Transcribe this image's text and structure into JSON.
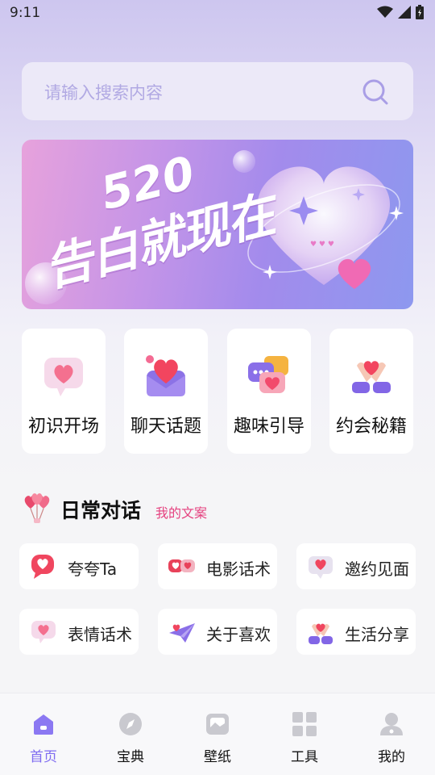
{
  "status_bar": {
    "time": "9:11"
  },
  "search": {
    "placeholder": "请输入搜索内容"
  },
  "banner": {
    "line1": "520",
    "line2": "告白就现在"
  },
  "features": [
    {
      "label": "初识开场",
      "icon": "heart-bubble-icon"
    },
    {
      "label": "聊天话题",
      "icon": "love-envelope-icon"
    },
    {
      "label": "趣味引导",
      "icon": "chat-bubbles-icon"
    },
    {
      "label": "约会秘籍",
      "icon": "hands-heart-icon"
    }
  ],
  "section": {
    "title": "日常对话",
    "subtitle": "我的文案"
  },
  "chips": [
    {
      "label": "夸夸Ta",
      "icon": "heart-speech-icon"
    },
    {
      "label": "电影话术",
      "icon": "double-heart-bubble-icon"
    },
    {
      "label": "邀约见面",
      "icon": "heart-message-icon"
    },
    {
      "label": "表情话术",
      "icon": "heart-bubble-icon"
    },
    {
      "label": "关于喜欢",
      "icon": "paper-plane-icon"
    },
    {
      "label": "生活分享",
      "icon": "hands-heart-icon"
    }
  ],
  "tabs": [
    {
      "label": "首页",
      "icon": "home-icon",
      "active": true
    },
    {
      "label": "宝典",
      "icon": "compass-icon"
    },
    {
      "label": "壁纸",
      "icon": "image-icon"
    },
    {
      "label": "工具",
      "icon": "grid-icon"
    },
    {
      "label": "我的",
      "icon": "user-icon"
    }
  ],
  "colors": {
    "accent": "#7f6cf1",
    "pink": "#e5417f",
    "search_bg": "#ece9f8"
  }
}
